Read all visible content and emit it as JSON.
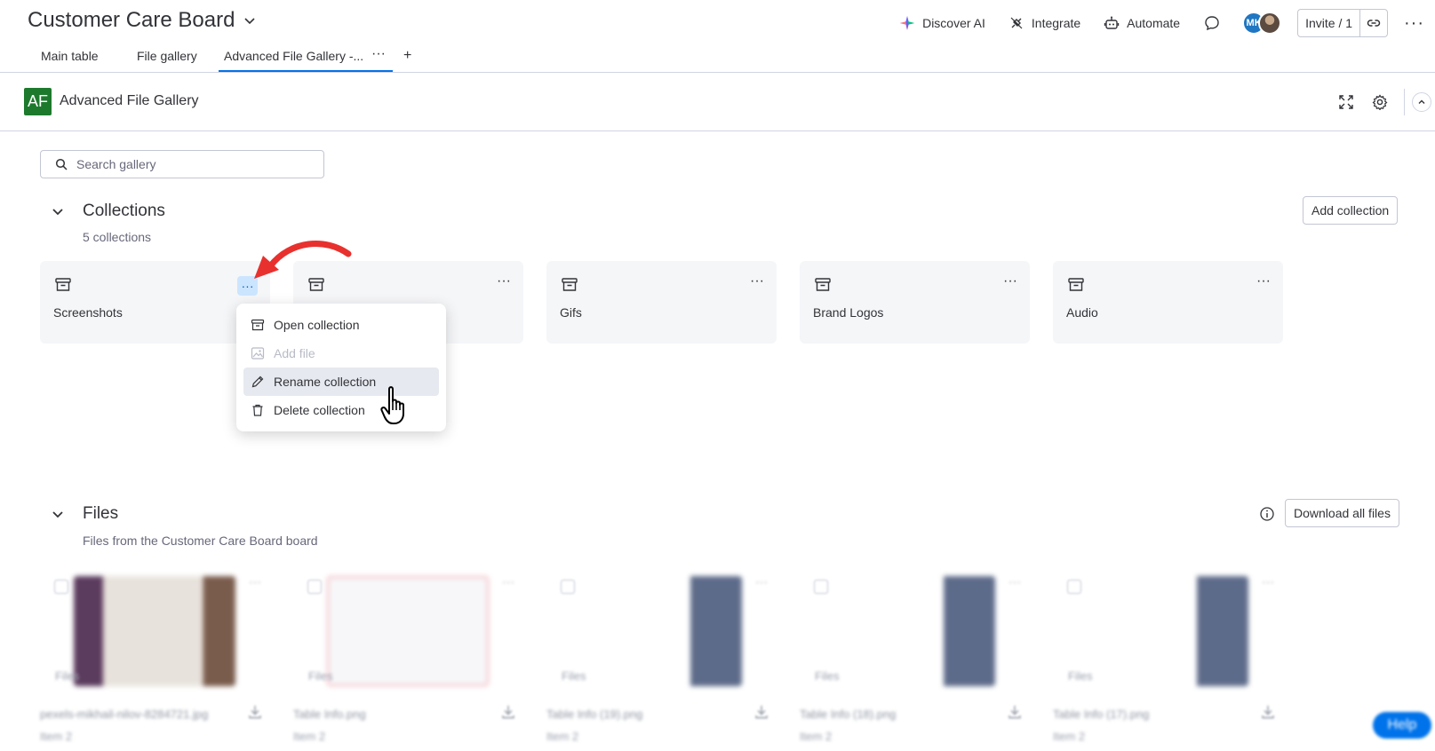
{
  "header": {
    "board_title": "Customer Care Board",
    "actions": [
      {
        "label": "Discover AI",
        "icon": "sparkle-icon"
      },
      {
        "label": "Integrate",
        "icon": "plug-icon"
      },
      {
        "label": "Automate",
        "icon": "robot-icon"
      }
    ],
    "avatar_initials": "MK",
    "invite_label": "Invite / 1",
    "more_glyph": "···"
  },
  "tabs": {
    "items": [
      "Main table",
      "File gallery",
      "Advanced File Gallery -..."
    ],
    "active_index": 2,
    "more_glyph": "···",
    "add_glyph": "+"
  },
  "app": {
    "logo_text": "AF",
    "title": "Advanced File Gallery"
  },
  "search": {
    "placeholder": "Search gallery"
  },
  "collections": {
    "title": "Collections",
    "subtitle": "5 collections",
    "add_label": "Add collection",
    "items": [
      {
        "name": "Screenshots"
      },
      {
        "name": ""
      },
      {
        "name": "Gifs"
      },
      {
        "name": "Brand Logos"
      },
      {
        "name": "Audio"
      }
    ],
    "more_glyph": "···"
  },
  "context_menu": {
    "items": [
      {
        "label": "Open collection",
        "icon": "archive-icon",
        "disabled": false
      },
      {
        "label": "Add file",
        "icon": "image-icon",
        "disabled": true
      },
      {
        "label": "Rename collection",
        "icon": "pencil-icon",
        "disabled": false
      },
      {
        "label": "Delete collection",
        "icon": "trash-icon",
        "disabled": false
      }
    ],
    "hovered_index": 2
  },
  "files": {
    "title": "Files",
    "subtitle": "Files from the Customer Care Board board",
    "download_all_label": "Download all files",
    "items": [
      {
        "name": "pexels-mikhail-nilov-8284721.jpg",
        "badge": "Files",
        "item": "Item 2"
      },
      {
        "name": "Table Info.png",
        "badge": "Files",
        "item": "Item 2"
      },
      {
        "name": "Table Info (19).png",
        "badge": "Files",
        "item": "Item 2"
      },
      {
        "name": "Table Info (18).png",
        "badge": "Files",
        "item": "Item 2"
      },
      {
        "name": "Table Info (17).png",
        "badge": "Files",
        "item": "Item 2"
      }
    ]
  },
  "help_label": "Help",
  "colors": {
    "primary": "#0073ea",
    "logo_green": "#1d7a2d",
    "card_bg": "#f5f6f8",
    "annotation_red": "#e8312e"
  }
}
